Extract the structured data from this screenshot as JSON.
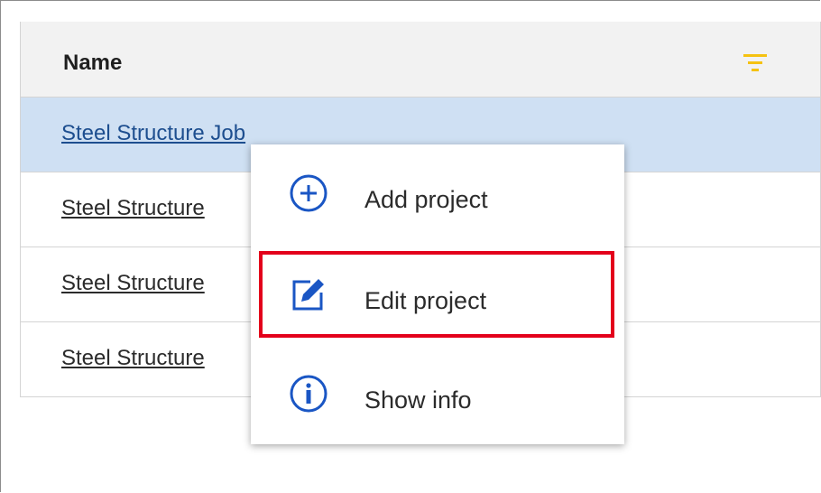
{
  "table": {
    "header": {
      "name_label": "Name",
      "filter_icon": "filter-icon",
      "filter_color": "#f5c211"
    },
    "rows": [
      {
        "label": "Steel Structure Job",
        "selected": true
      },
      {
        "label": "Steel Structure"
      },
      {
        "label": "Steel Structure"
      },
      {
        "label": "Steel Structure"
      }
    ],
    "selected_color": "#cfe0f3"
  },
  "context_menu": {
    "items": [
      {
        "label": "Add project",
        "icon": "add-circle-icon"
      },
      {
        "label": "Edit project",
        "icon": "edit-icon"
      },
      {
        "label": "Show info",
        "icon": "info-icon"
      }
    ],
    "highlight_color": "#e3001b",
    "icon_color": "#1a56c4"
  }
}
